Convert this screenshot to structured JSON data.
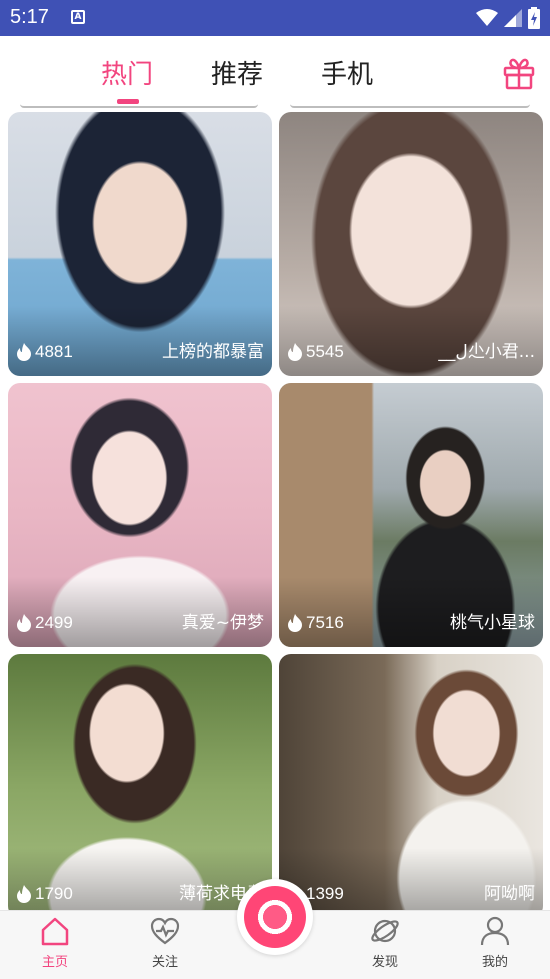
{
  "status": {
    "time": "5:17"
  },
  "tabs": [
    {
      "label": "热门",
      "active": true
    },
    {
      "label": "推荐",
      "active": false
    },
    {
      "label": "手机",
      "active": false
    }
  ],
  "cards": [
    {
      "heat": "4881",
      "name": "上榜的都暴富",
      "palette": [
        "#2a3a55",
        "#7fb3d8",
        "#e9d9cf"
      ]
    },
    {
      "heat": "5545",
      "name": "__ل尐小君...",
      "palette": [
        "#6d5b55",
        "#c9b8ad",
        "#efe4de"
      ]
    },
    {
      "heat": "2499",
      "name": "真爱~伊梦",
      "palette": [
        "#e8a9b7",
        "#f3d6dc",
        "#5a4a5e"
      ]
    },
    {
      "heat": "7516",
      "name": "桃气小星球",
      "palette": [
        "#7e6a55",
        "#b7c2c4",
        "#2c2c2c"
      ]
    },
    {
      "heat": "1790",
      "name": "薄荷求电费",
      "palette": [
        "#6f8a4e",
        "#b3c98e",
        "#f1e8e0"
      ]
    },
    {
      "heat": "1399",
      "name": "阿呦啊",
      "palette": [
        "#5b4a3a",
        "#c7b9a4",
        "#f0ede8"
      ]
    }
  ],
  "nav": [
    {
      "label": "主页",
      "icon": "home-icon",
      "active": true
    },
    {
      "label": "关注",
      "icon": "heart-pulse-icon",
      "active": false
    },
    {
      "label": "发现",
      "icon": "planet-icon",
      "active": false
    },
    {
      "label": "我的",
      "icon": "person-icon",
      "active": false
    }
  ],
  "colors": {
    "accent": "#f2457f",
    "statusbar": "#3f51b5"
  }
}
